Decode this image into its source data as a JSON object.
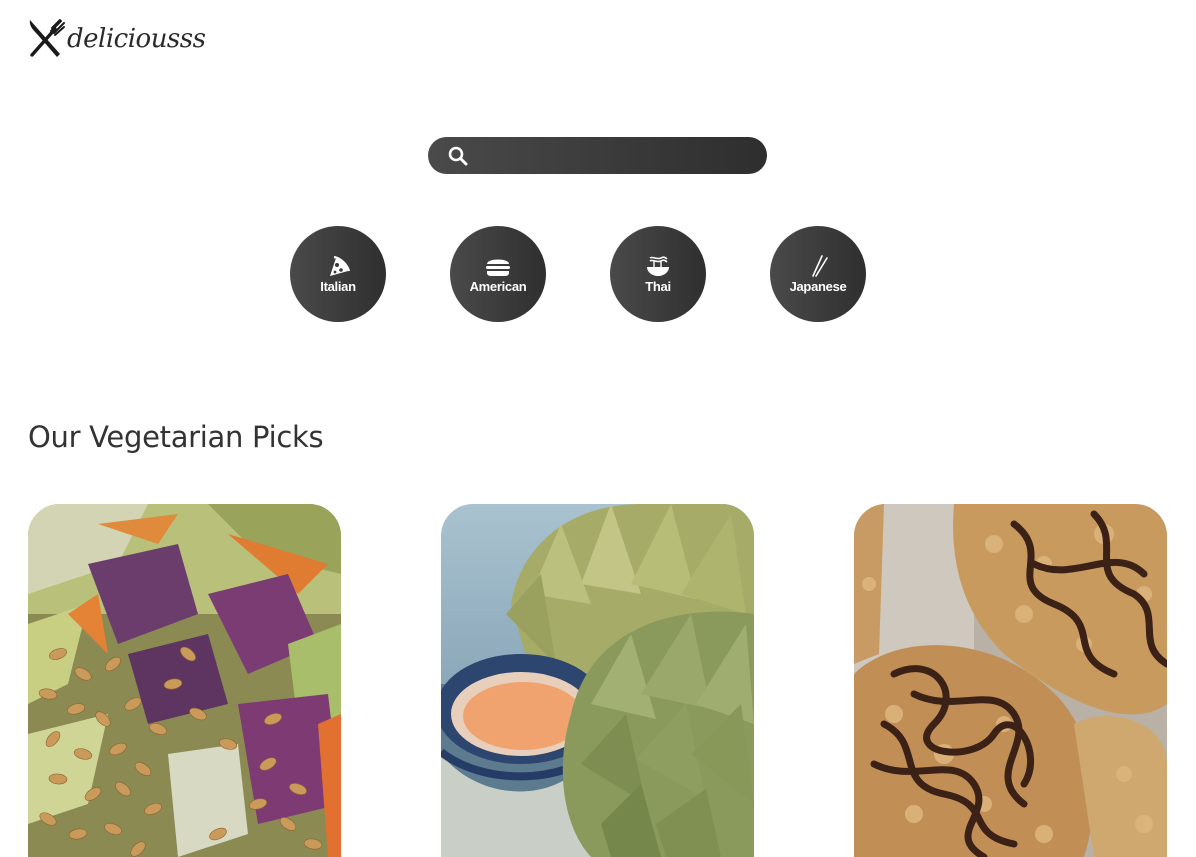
{
  "brand": {
    "name": "deliciousss",
    "icon": "fork-knife-icon"
  },
  "search": {
    "icon": "search-icon",
    "value": "",
    "placeholder": ""
  },
  "categories": [
    {
      "label": "Italian",
      "icon": "pizza-icon"
    },
    {
      "label": "American",
      "icon": "burger-icon"
    },
    {
      "label": "Thai",
      "icon": "noodle-bowl-icon"
    },
    {
      "label": "Japanese",
      "icon": "chopsticks-icon"
    }
  ],
  "section": {
    "title": "Our Vegetarian Picks"
  },
  "recipes": [
    {
      "image": "salad-photo"
    },
    {
      "image": "artichoke-photo"
    },
    {
      "image": "chocolate-dessert-photo"
    }
  ],
  "colors": {
    "dark": "#333333",
    "background": "#ffffff"
  }
}
